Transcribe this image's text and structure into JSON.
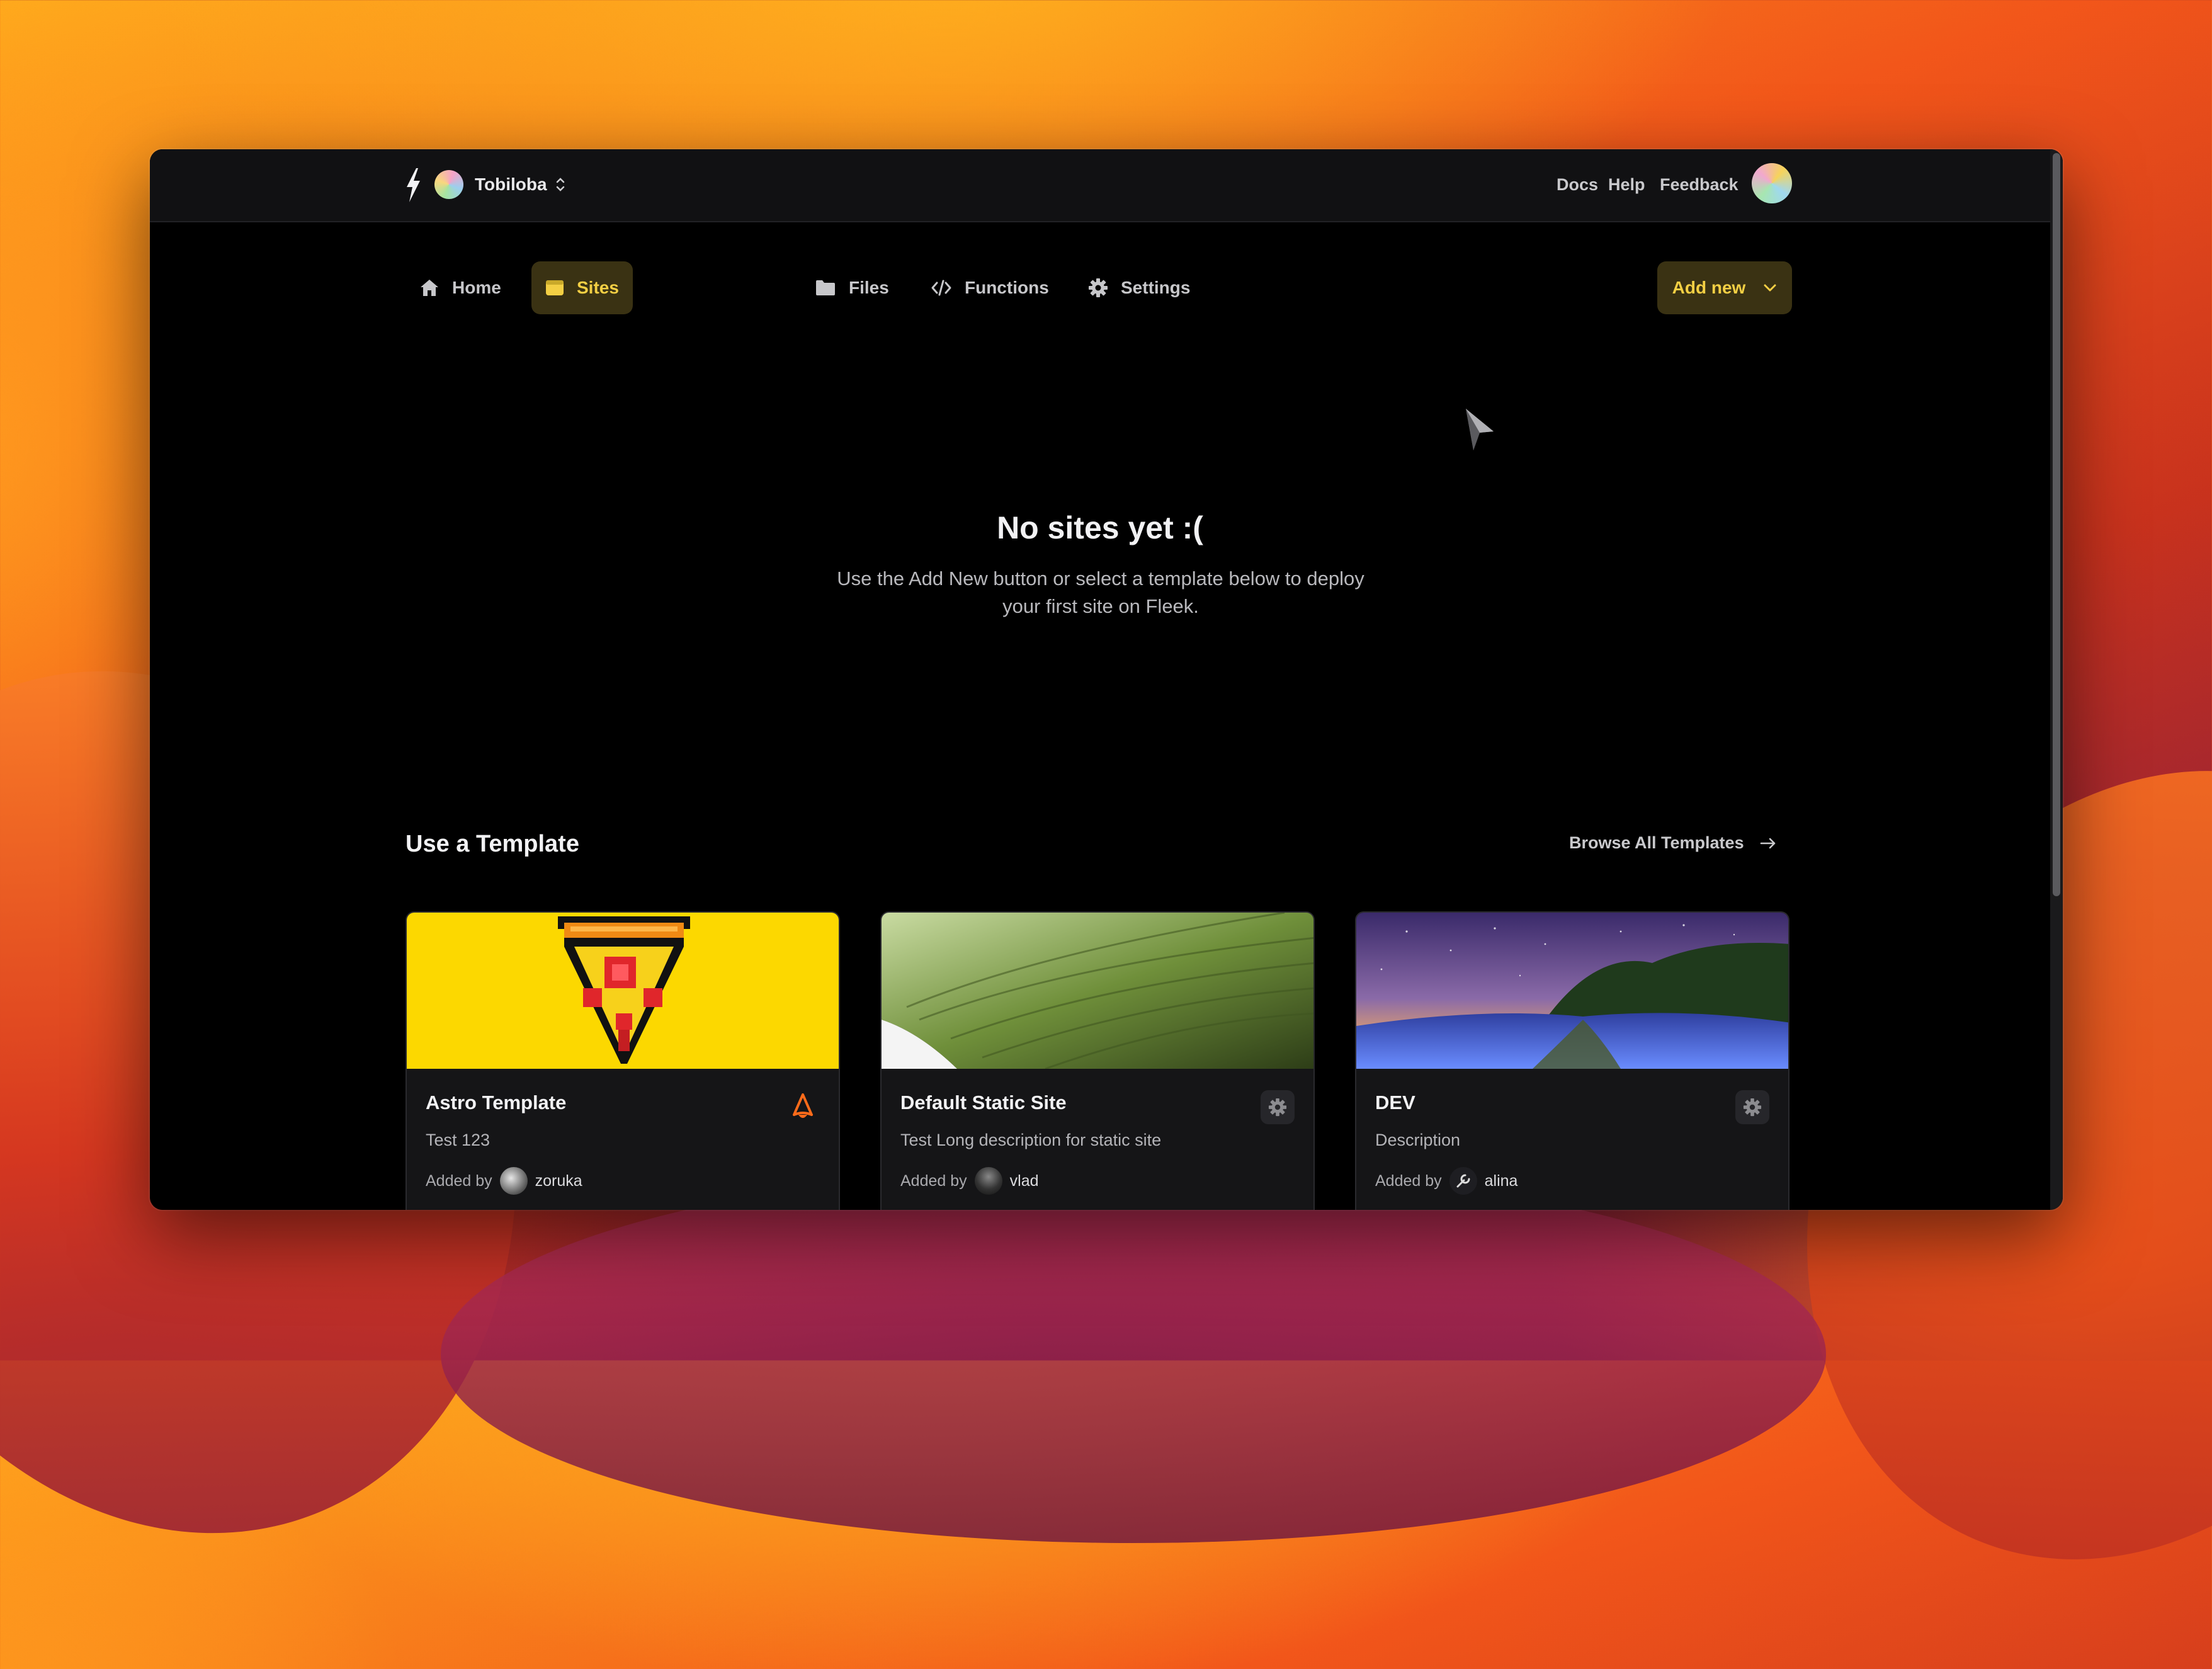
{
  "header": {
    "workspace_name": "Tobiloba",
    "links": [
      "Docs",
      "Help",
      "Feedback"
    ]
  },
  "nav": {
    "items": [
      {
        "label": "Home",
        "icon": "home-icon"
      },
      {
        "label": "Sites",
        "icon": "sites-icon",
        "active": true
      },
      {
        "label": "Files",
        "icon": "folder-icon"
      },
      {
        "label": "Functions",
        "icon": "code-icon"
      },
      {
        "label": "Settings",
        "icon": "gear-icon"
      }
    ],
    "add_new_label": "Add new"
  },
  "empty_state": {
    "title": "No sites yet :(",
    "description": "Use the Add New button or select a template below to deploy your first site on Fleek."
  },
  "templates": {
    "section_title": "Use a Template",
    "browse_label": "Browse All Templates",
    "added_by_label": "Added by",
    "cards": [
      {
        "title": "Astro Template",
        "description": "Test 123",
        "author": "zoruka",
        "badge_icon": "astro-icon",
        "thumb": "pixel-pizza"
      },
      {
        "title": "Default Static Site",
        "description": "Test Long description for static site",
        "author": "vlad",
        "badge_icon": "gear-icon",
        "thumb": "green-leaf"
      },
      {
        "title": "DEV",
        "description": "Description",
        "author": "alina",
        "badge_icon": "gear-icon",
        "thumb": "night-field"
      }
    ]
  },
  "colors": {
    "accent": "#f3cf44",
    "accent_bg": "#3a3213",
    "window_bg": "#000000",
    "topbar_bg": "#111113"
  }
}
